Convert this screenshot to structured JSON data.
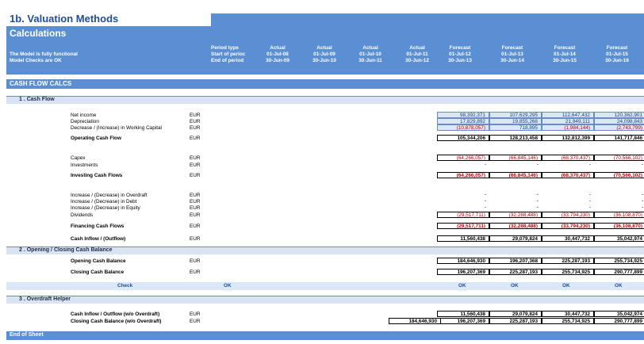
{
  "sheet_title": "1b. Valuation Methods",
  "calc_title": "Calculations",
  "status1": "The Model is fully functional",
  "status2": "Model Checks are OK",
  "period_labels": [
    "Period type",
    "Start of perioc",
    "End of period"
  ],
  "columns": [
    {
      "type": "Actual",
      "start": "01-Jul-08",
      "end": "30-Jun-09"
    },
    {
      "type": "Actual",
      "start": "01-Jul-09",
      "end": "30-Jun-10"
    },
    {
      "type": "Actual",
      "start": "01-Jul-10",
      "end": "30-Jun-11"
    },
    {
      "type": "Actual",
      "start": "01-Jul-11",
      "end": "30-Jun-12"
    },
    {
      "type": "Forecast",
      "start": "01-Jul-12",
      "end": "30-Jun-13"
    },
    {
      "type": "Forecast",
      "start": "01-Jul-13",
      "end": "30-Jun-14"
    },
    {
      "type": "Forecast",
      "start": "01-Jul-14",
      "end": "30-Jun-15"
    },
    {
      "type": "Forecast",
      "start": "01-Jul-15",
      "end": "30-Jun-16"
    }
  ],
  "section_main": "CASH FLOW CALCS",
  "sub1": "1 . Cash Flow",
  "sub2": "2 . Opening / Closing Cash Balance",
  "sub3": "3 . Overdraft Helper",
  "end": "End of Sheet",
  "unit": "EUR",
  "check_label": "Check",
  "check_ok": "OK",
  "rows": {
    "net_income": {
      "label": "Net income",
      "values": [
        "98,392,371",
        "107,629,295",
        "112,647,432",
        "120,362,901"
      ]
    },
    "depreciation": {
      "label": "Depreciation",
      "values": [
        "17,829,892",
        "19,855,268",
        "21,949,111",
        "24,098,843"
      ]
    },
    "wc": {
      "label": "Decrease / (Increase) in Working Capital",
      "values": [
        "(10,878,057)",
        "718,895",
        "(1,984,144)",
        "(2,743,799)"
      ]
    },
    "ocf": {
      "label": "Operating Cash Flow",
      "values": [
        "105,344,206",
        "128,213,458",
        "132,812,399",
        "141,717,846"
      ]
    },
    "capex": {
      "label": "Capex",
      "values": [
        "(64,266,057)",
        "(66,845,146)",
        "(68,370,437)",
        "(70,566,102)"
      ]
    },
    "investments": {
      "label": "Investments",
      "values": [
        "-",
        "-",
        "-",
        "-"
      ]
    },
    "icf": {
      "label": "Investing Cash Flows",
      "values": [
        "(64,266,057)",
        "(66,845,146)",
        "(68,370,437)",
        "(70,566,102)"
      ]
    },
    "overdraft": {
      "label": "Increase / (Decrease) in Overdraft",
      "values": [
        "-",
        "-",
        "-",
        "-"
      ]
    },
    "debt": {
      "label": "Increase / (Decrease) in Debt",
      "values": [
        "-",
        "-",
        "-",
        "-"
      ]
    },
    "equity": {
      "label": "Increase / (Decrease) in Equity",
      "values": [
        "-",
        "-",
        "-",
        "-"
      ]
    },
    "dividends": {
      "label": "Dividends",
      "values": [
        "(29,517,711)",
        "(32,288,488)",
        "(33,794,230)",
        "(36,108,870)"
      ]
    },
    "fcf": {
      "label": "Financing Cash Flows",
      "values": [
        "(29,517,711)",
        "(32,288,488)",
        "(33,794,230)",
        "(36,108,870)"
      ]
    },
    "inout": {
      "label": "Cash Inflow / (Outflow)",
      "values": [
        "11,560,438",
        "29,079,824",
        "30,447,732",
        "35,042,974"
      ]
    },
    "opening": {
      "label": "Opening Cash Balance",
      "values": [
        "184,646,930",
        "196,207,368",
        "225,287,193",
        "255,734,925"
      ]
    },
    "closing": {
      "label": "Closing Cash Balance",
      "values": [
        "196,207,369",
        "225,287,193",
        "255,734,925",
        "290,777,899"
      ]
    },
    "inout_wo": {
      "label": "Cash Inflow / Outflow (w/o Overdraft)",
      "values": [
        "11,560,438",
        "29,079,824",
        "30,447,732",
        "35,042,974"
      ]
    },
    "closing_wo": {
      "label": "Closing Cash Balance (w/o Overdraft)",
      "actual_last": "184,646,930",
      "values": [
        "196,207,369",
        "225,287,193",
        "255,734,925",
        "290,777,899"
      ]
    }
  }
}
